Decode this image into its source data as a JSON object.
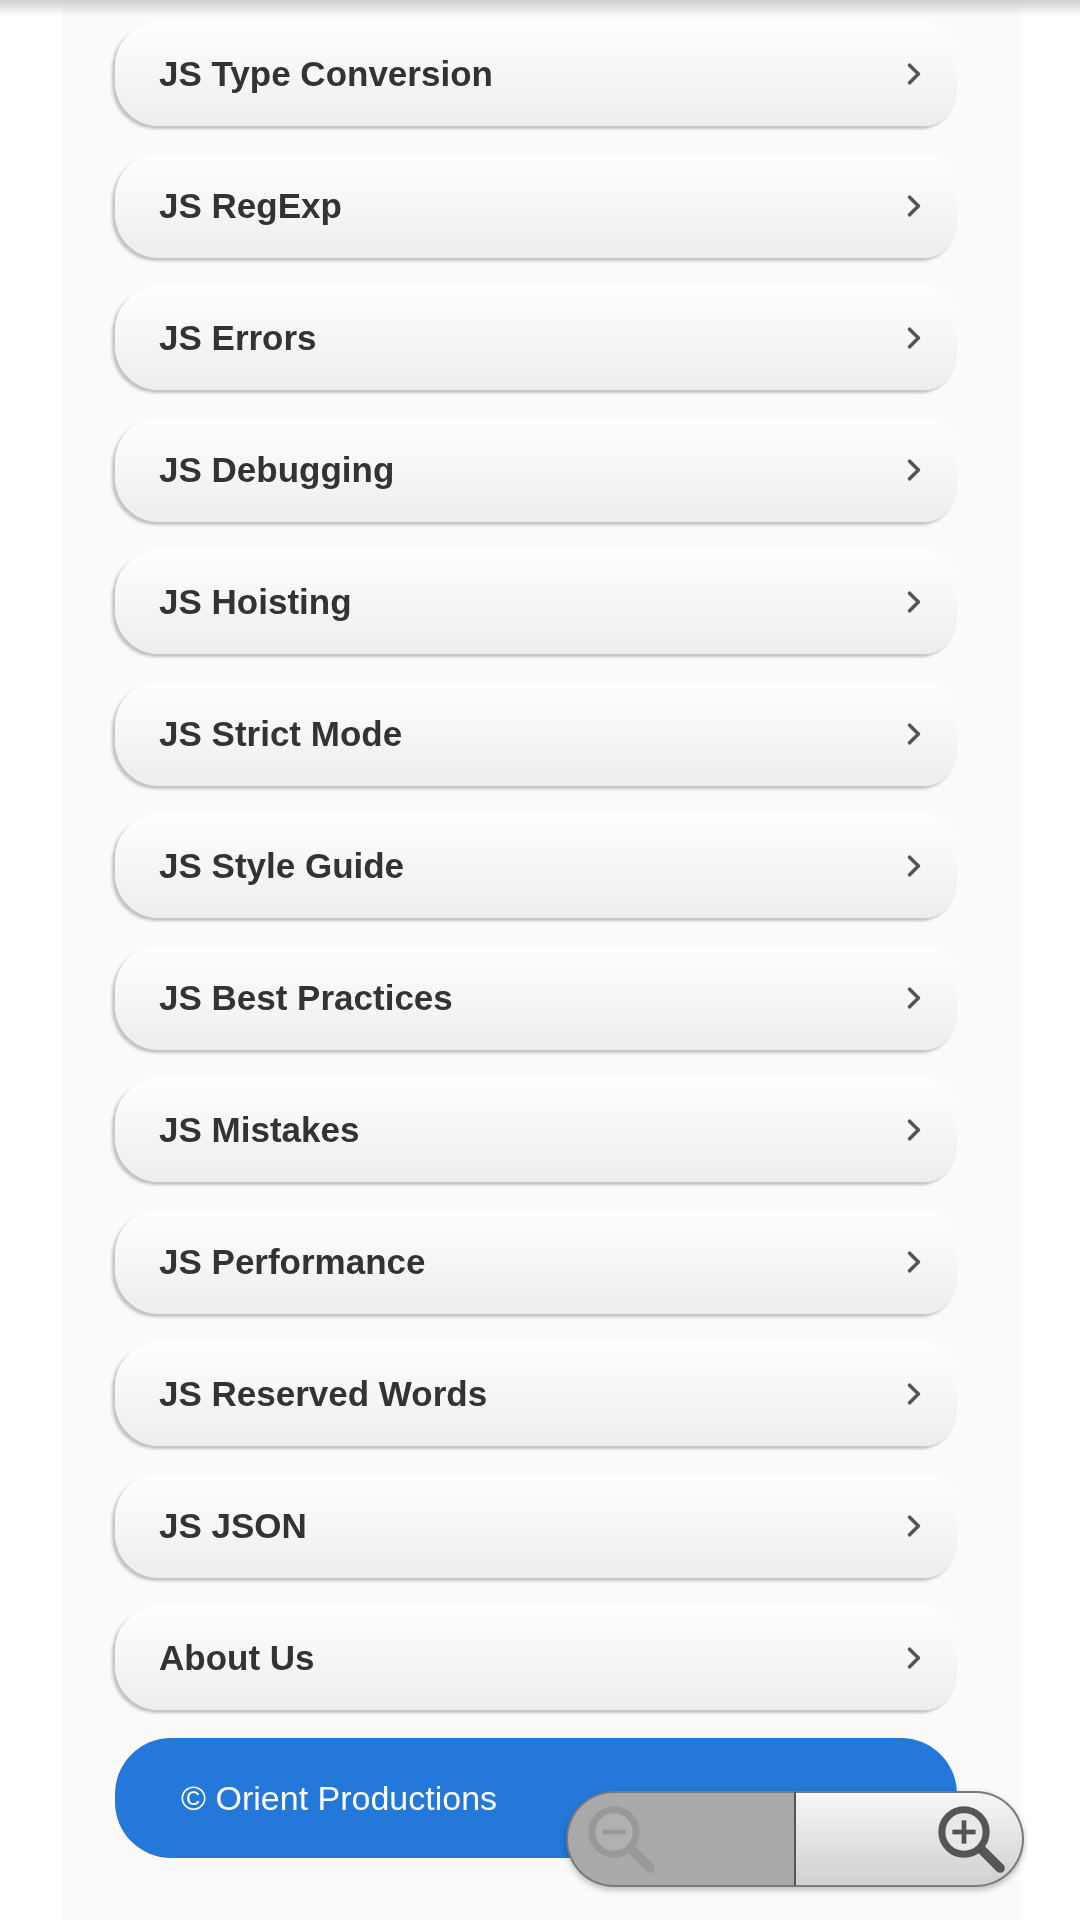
{
  "menu_items": [
    {
      "label": "JS Type Conversion"
    },
    {
      "label": "JS RegExp"
    },
    {
      "label": "JS Errors"
    },
    {
      "label": "JS Debugging"
    },
    {
      "label": "JS Hoisting"
    },
    {
      "label": "JS Strict Mode"
    },
    {
      "label": "JS Style Guide"
    },
    {
      "label": "JS Best Practices"
    },
    {
      "label": "JS Mistakes"
    },
    {
      "label": "JS Performance"
    },
    {
      "label": "JS Reserved Words"
    },
    {
      "label": "JS JSON"
    },
    {
      "label": "About Us"
    }
  ],
  "footer": {
    "text": "© Orient Productions"
  },
  "zoom_controls": {
    "zoom_out": {
      "disabled": true
    },
    "zoom_in": {
      "disabled": false
    }
  }
}
